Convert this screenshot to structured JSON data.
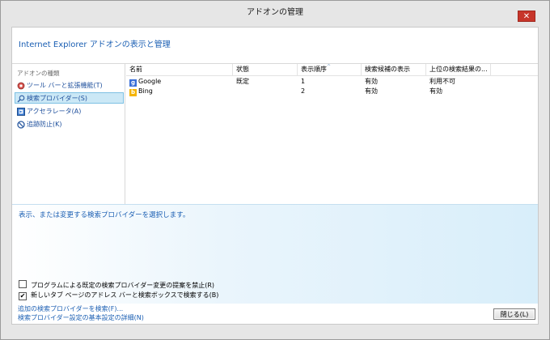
{
  "window": {
    "title": "アドオンの管理",
    "close_glyph": "✕"
  },
  "header": {
    "title": "Internet Explorer アドオンの表示と管理"
  },
  "sidebar": {
    "caption": "アドオンの種類",
    "items": [
      {
        "label": "ツール バーと拡張機能(T)",
        "icon": "gear-icon",
        "selected": false
      },
      {
        "label": "検索プロバイダー(S)",
        "icon": "search-icon",
        "selected": true
      },
      {
        "label": "アクセラレータ(A)",
        "icon": "accelerator-icon",
        "selected": false
      },
      {
        "label": "追跡防止(K)",
        "icon": "block-icon",
        "selected": false
      }
    ]
  },
  "table": {
    "columns": [
      "名前",
      "状態",
      "表示順序",
      "検索候補の表示",
      "上位の検索結果の..."
    ],
    "sort_indicator": "^",
    "rows": [
      {
        "icon": "google-icon",
        "name": "Google",
        "status": "既定",
        "order": "1",
        "suggestions": "有効",
        "top_result": "利用不可"
      },
      {
        "icon": "bing-icon",
        "name": "Bing",
        "status": "",
        "order": "2",
        "suggestions": "有効",
        "top_result": "有効"
      }
    ]
  },
  "details": {
    "hint": "表示、または変更する検索プロバイダーを選択します。",
    "checkboxes": [
      {
        "label": "プログラムによる既定の検索プロバイダー変更の提案を禁止(R)",
        "checked": false,
        "mark": ""
      },
      {
        "label": "新しいタブ ページのアドレス バーと検索ボックスで検索する(B)",
        "checked": true,
        "mark": "✔"
      }
    ]
  },
  "footer": {
    "links": [
      "追加の検索プロバイダーを検索(F)...",
      "検索プロバイダー設定の基本設定の詳細(N)"
    ],
    "close_button": "閉じる(L)"
  },
  "colors": {
    "accent_text": "#1b5fb3",
    "selection_bg": "#cbe8f6",
    "close_red": "#c7352a",
    "google_blue": "#3a6fd8",
    "bing_yellow": "#f5b400"
  }
}
